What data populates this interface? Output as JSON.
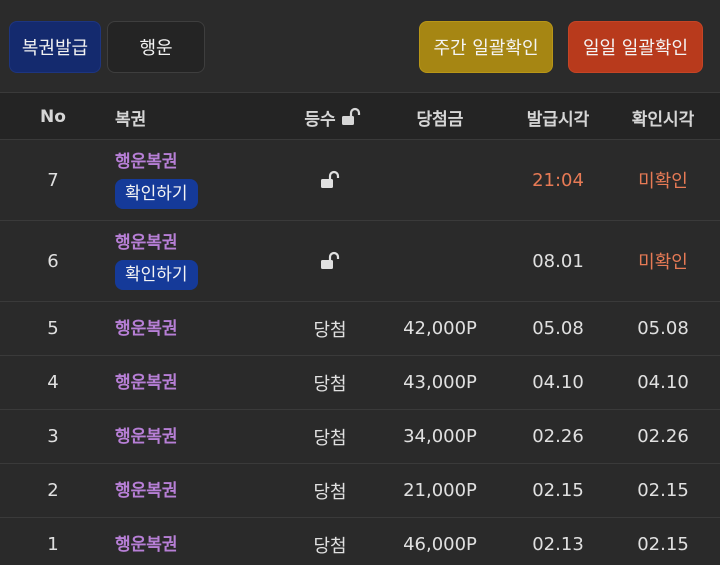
{
  "toolbar": {
    "issue_label": "복권발급",
    "luck_label": "행운",
    "weekly_label": "주간 일괄확인",
    "daily_label": "일일 일괄확인"
  },
  "table": {
    "headers": {
      "no": "No",
      "name": "복권",
      "rank": "등수",
      "prize": "당첨금",
      "issue_time": "발급시각",
      "check_time": "확인시각"
    },
    "rows": [
      {
        "no": "7",
        "name": "행운복권",
        "action": "확인하기",
        "rank_icon": "unlock-icon",
        "prize": "",
        "issue_time": "21:04",
        "check_time": "미확인"
      },
      {
        "no": "6",
        "name": "행운복권",
        "action": "확인하기",
        "rank_icon": "unlock-icon",
        "prize": "",
        "issue_time": "08.01",
        "check_time": "미확인"
      },
      {
        "no": "5",
        "name": "행운복권",
        "rank": "당첨",
        "prize": "42,000P",
        "issue_time": "05.08",
        "check_time": "05.08"
      },
      {
        "no": "4",
        "name": "행운복권",
        "rank": "당첨",
        "prize": "43,000P",
        "issue_time": "04.10",
        "check_time": "04.10"
      },
      {
        "no": "3",
        "name": "행운복권",
        "rank": "당첨",
        "prize": "34,000P",
        "issue_time": "02.26",
        "check_time": "02.26"
      },
      {
        "no": "2",
        "name": "행운복권",
        "rank": "당첨",
        "prize": "21,000P",
        "issue_time": "02.15",
        "check_time": "02.15"
      },
      {
        "no": "1",
        "name": "행운복권",
        "rank": "당첨",
        "prize": "46,000P",
        "issue_time": "02.13",
        "check_time": "02.15"
      }
    ]
  },
  "colors": {
    "accent_orange": "#e77a55",
    "name_purple": "#b77fd6",
    "confirm_blue": "#153a99",
    "weekly_gold": "#a68613",
    "daily_red": "#b83a1c"
  }
}
